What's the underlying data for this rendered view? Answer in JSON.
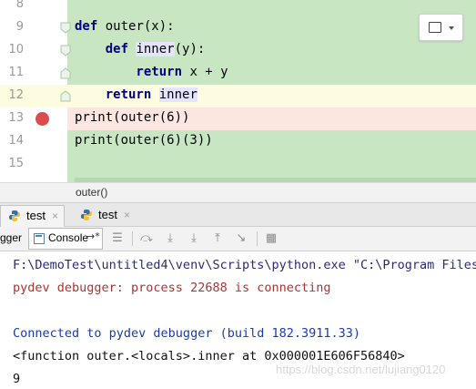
{
  "editor": {
    "lines": [
      {
        "num": "8",
        "tokens": []
      },
      {
        "num": "9",
        "tokens": [
          {
            "t": "def",
            "c": "kw"
          },
          {
            "t": " outer(x):",
            "c": ""
          }
        ]
      },
      {
        "num": "10",
        "tokens": [
          {
            "t": "    def",
            "c": "kw"
          },
          {
            "t": " ",
            "c": ""
          },
          {
            "t": "inner",
            "c": "ident-hl"
          },
          {
            "t": "(y):",
            "c": ""
          }
        ]
      },
      {
        "num": "11",
        "tokens": [
          {
            "t": "        return",
            "c": "kw"
          },
          {
            "t": " x + y",
            "c": ""
          }
        ]
      },
      {
        "num": "12",
        "tokens": [
          {
            "t": "    return",
            "c": "kw"
          },
          {
            "t": " ",
            "c": ""
          },
          {
            "t": "inner",
            "c": "ident-hl"
          }
        ]
      },
      {
        "num": "13",
        "tokens": [
          {
            "t": "print(outer(6))",
            "c": ""
          }
        ]
      },
      {
        "num": "14",
        "tokens": [
          {
            "t": "print(outer(6)(3))",
            "c": ""
          }
        ]
      },
      {
        "num": "15",
        "tokens": []
      }
    ],
    "breakpoint_line": "13",
    "caret_line": "12"
  },
  "breadcrumb": "outer()",
  "run_tabs": [
    {
      "label": "test",
      "close": "×"
    },
    {
      "label": "test",
      "close": "×"
    }
  ],
  "toolbar": {
    "debugger_label": "gger",
    "console_label": "Console",
    "console_arrow": "→*"
  },
  "console": {
    "lines": [
      {
        "text": "F:\\DemoTest\\untitled4\\venv\\Scripts\\python.exe \"C:\\Program Files",
        "color": "c-dark"
      },
      {
        "text": "pydev debugger: process 22688 is connecting",
        "color": "c-red"
      },
      {
        "text": "",
        "color": "c-black"
      },
      {
        "text": "Connected to pydev debugger (build 182.3911.33)",
        "color": "c-blue"
      },
      {
        "text": "<function outer.<locals>.inner at 0x000001E606F56840>",
        "color": "c-black"
      },
      {
        "text": "9",
        "color": "c-black"
      }
    ],
    "watermark": "https://blog.csdn.net/lujiang0120"
  },
  "colors": {
    "code_bg": "#c8e6c2",
    "keyword": "#000080",
    "breakpoint": "#db4c4c",
    "console_red": "#b03232",
    "console_blue": "#1a3bb0"
  }
}
